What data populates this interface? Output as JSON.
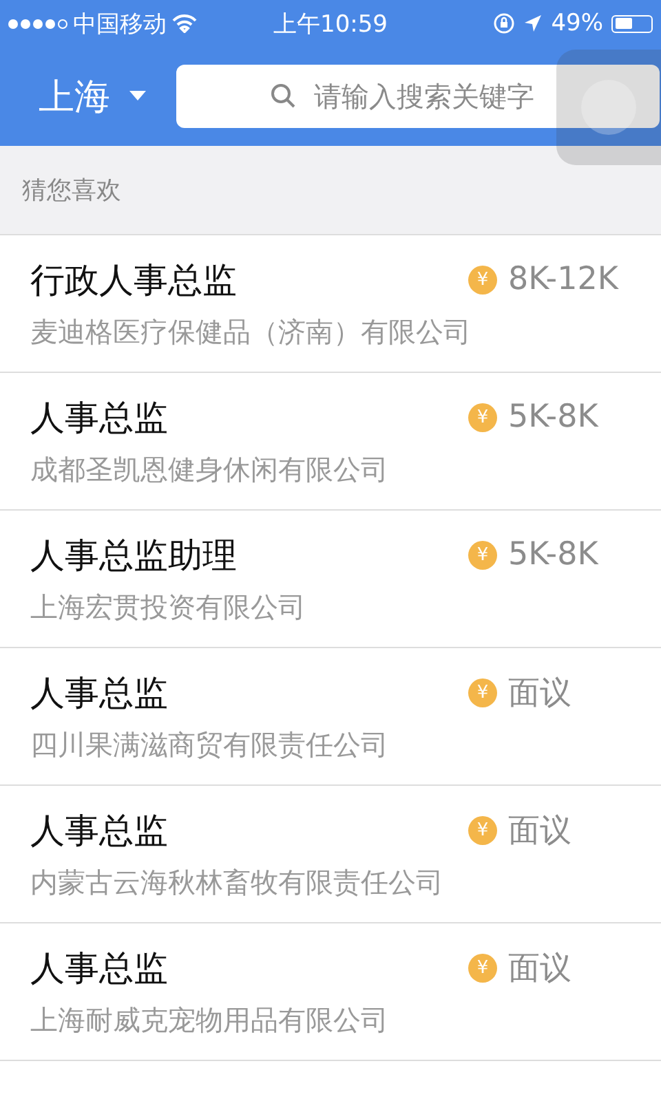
{
  "status_bar": {
    "carrier": "中国移动",
    "time": "上午10:59",
    "battery": "49%"
  },
  "header": {
    "city": "上海",
    "search": {
      "placeholder": "请输入搜索关键字"
    }
  },
  "section_title": "猜您喜欢",
  "jobs": [
    {
      "title": "行政人事总监",
      "company": "麦迪格医疗保健品（济南）有限公司",
      "currency": "¥",
      "salary": "8K-12K"
    },
    {
      "title": "人事总监",
      "company": "成都圣凯恩健身休闲有限公司",
      "currency": "¥",
      "salary": "5K-8K"
    },
    {
      "title": "人事总监助理",
      "company": "上海宏贯投资有限公司",
      "currency": "¥",
      "salary": "5K-8K"
    },
    {
      "title": "人事总监",
      "company": "四川果满滋商贸有限责任公司",
      "currency": "¥",
      "salary": "面议"
    },
    {
      "title": "人事总监",
      "company": "内蒙古云海秋林畜牧有限责任公司",
      "currency": "¥",
      "salary": "面议"
    },
    {
      "title": "人事总监",
      "company": "上海耐威克宠物用品有限公司",
      "currency": "¥",
      "salary": "面议"
    }
  ]
}
